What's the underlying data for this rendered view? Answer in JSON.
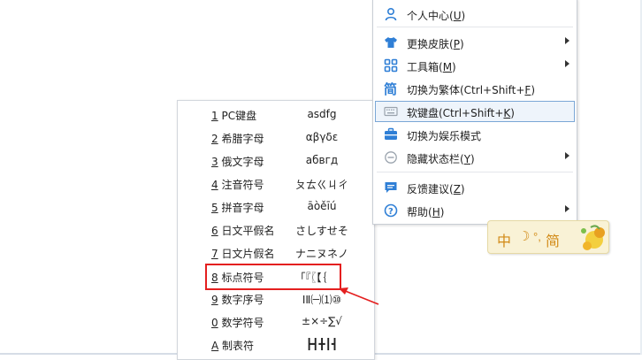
{
  "soft_keyboard_list": [
    {
      "key": "1",
      "label": " PC键盘",
      "preview": "asdfg"
    },
    {
      "key": "2",
      "label": " 希腊字母",
      "preview": "αβγδε"
    },
    {
      "key": "3",
      "label": " 俄文字母",
      "preview": "абвгд"
    },
    {
      "key": "4",
      "label": " 注音符号",
      "preview": "ㄆㄊㄍㄐㄔ"
    },
    {
      "key": "5",
      "label": " 拼音字母",
      "preview": "āòěīú"
    },
    {
      "key": "6",
      "label": " 日文平假名",
      "preview": "さしすせそ"
    },
    {
      "key": "7",
      "label": " 日文片假名",
      "preview": "ナニヌネノ"
    },
    {
      "key": "8",
      "label": " 标点符号",
      "preview": "「『〖【｛"
    },
    {
      "key": "9",
      "label": " 数字序号",
      "preview": "ⅠⅡ㈠⑴⑩"
    },
    {
      "key": "0",
      "label": " 数学符号",
      "preview": "±×÷∑√"
    },
    {
      "key": "A",
      "label": " 制表符",
      "preview": "┣┫╋┃┫"
    }
  ],
  "context_menu": {
    "items": [
      {
        "label": "个人中心(",
        "hotkey": "U",
        "suffix": ")",
        "icon": "user-icon",
        "submenu": false
      },
      {
        "label": "更换皮肤(",
        "hotkey": "P",
        "suffix": ")",
        "icon": "shirt-icon",
        "submenu": true
      },
      {
        "label": "工具箱(",
        "hotkey": "M",
        "suffix": ")",
        "icon": "grid-icon",
        "submenu": true
      },
      {
        "label": "切换为繁体(Ctrl+Shift+",
        "hotkey": "F",
        "suffix": ")",
        "icon": "jian-icon",
        "submenu": false
      },
      {
        "label": "软键盘(Ctrl+Shift+",
        "hotkey": "K",
        "suffix": ")",
        "icon": "keyboard-icon",
        "submenu": false
      },
      {
        "label": "切换为娱乐模式",
        "hotkey": "",
        "suffix": "",
        "icon": "briefcase-icon",
        "submenu": false
      },
      {
        "label": "隐藏状态栏(",
        "hotkey": "Y",
        "suffix": ")",
        "icon": "minus-circle-icon",
        "submenu": true
      },
      {
        "label": "反馈建议(",
        "hotkey": "Z",
        "suffix": ")",
        "icon": "chat-icon",
        "submenu": false
      },
      {
        "label": "帮助(",
        "hotkey": "H",
        "suffix": ")",
        "icon": "help-icon",
        "submenu": true
      }
    ]
  },
  "status_bar": {
    "mode": "中",
    "moon": "☽",
    "punct": "°,",
    "script": "简"
  },
  "colors": {
    "highlight_box": "#e41f1f",
    "accent_blue": "#2f7fd6",
    "status_text": "#d28a16"
  }
}
